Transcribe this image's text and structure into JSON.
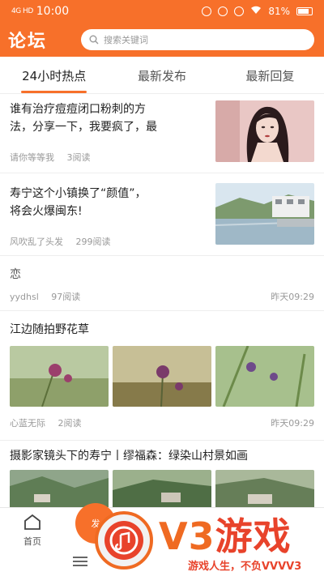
{
  "status_bar": {
    "signal": "4G HD",
    "time": "10:00",
    "battery": "81%"
  },
  "header": {
    "title": "论坛",
    "search_placeholder": "搜索关键词"
  },
  "tabs": [
    {
      "label": "24小时热点",
      "active": true
    },
    {
      "label": "最新发布",
      "active": false
    },
    {
      "label": "最新回复",
      "active": false
    }
  ],
  "posts": [
    {
      "title_line1": "谁有治疗痘痘闭口粉刺的方",
      "title_line2": "法，分享一下，我要疯了，最",
      "author": "请你等等我",
      "reads": "3阅读"
    },
    {
      "title_line1": "寿宁这个小镇换了“颜值”，",
      "title_line2": "将会火爆闽东!",
      "author": "风吹乱了头发",
      "reads": "299阅读"
    },
    {
      "title_line1": "恋",
      "author": "yydhsl",
      "reads": "97阅读",
      "time": "昨天09:29"
    },
    {
      "title_line1": "江边随拍野花草",
      "author": "心蓝无际",
      "reads": "2阅读",
      "time": "昨天09:29"
    },
    {
      "title_line1": "摄影家镜头下的寿宁丨缪福森：绿染山村景如画"
    }
  ],
  "bottom_nav": {
    "home_label": "首页",
    "post_label": "发"
  },
  "watermark": {
    "brand_v3": "V3",
    "brand_cn": "游戏",
    "slogan": "游戏人生，不负VVVV3"
  },
  "colors": {
    "accent": "#f7702a",
    "watermark_red": "#e8432b"
  }
}
